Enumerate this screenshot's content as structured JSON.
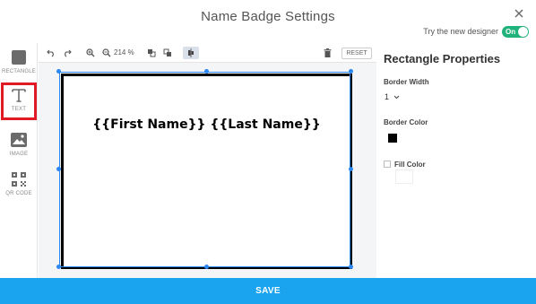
{
  "header": {
    "title": "Name Badge Settings",
    "new_designer_label": "Try the new designer",
    "toggle_label": "On"
  },
  "tools": [
    {
      "label": "RECTANGLE",
      "icon": "rectangle-icon"
    },
    {
      "label": "TEXT",
      "icon": "text-icon"
    },
    {
      "label": "IMAGE",
      "icon": "image-icon"
    },
    {
      "label": "QR CODE",
      "icon": "qr-code-icon"
    }
  ],
  "toolbar": {
    "zoom_level": "214 %",
    "reset_label": "RESET"
  },
  "badge": {
    "merge_text": "{{First Name}} {{Last Name}}"
  },
  "properties": {
    "title": "Rectangle Properties",
    "border_width_label": "Border Width",
    "border_width_value": "1",
    "border_color_label": "Border Color",
    "border_color": "#000000",
    "fill_color_label": "Fill Color",
    "fill_color_checked": false
  },
  "footer": {
    "save_label": "SAVE"
  },
  "colors": {
    "accent": "#1aa3ef",
    "toggle": "#20b27b",
    "selection": "#2b87f1",
    "highlight": "#e01b24"
  }
}
